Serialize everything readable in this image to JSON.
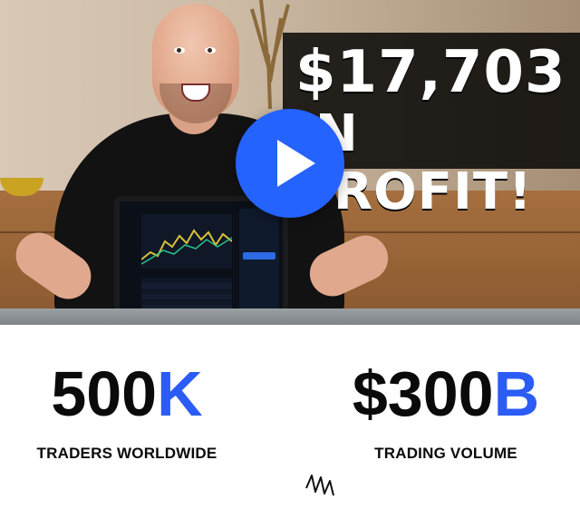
{
  "video": {
    "headline_line1": "$17,703",
    "headline_line2": "IN PROFIT!",
    "play_icon": "play-icon",
    "play_color": "#2563ff"
  },
  "stats": [
    {
      "value_main": "500",
      "value_accent": "K",
      "label": "TRADERS WORLDWIDE"
    },
    {
      "value_main": "$300",
      "value_accent": "B",
      "label": "TRADING VOLUME"
    }
  ],
  "colors": {
    "accent": "#2b5cf6",
    "text": "#0a0a0a",
    "background": "#ffffff"
  },
  "decor_icon": "squiggle-icon"
}
